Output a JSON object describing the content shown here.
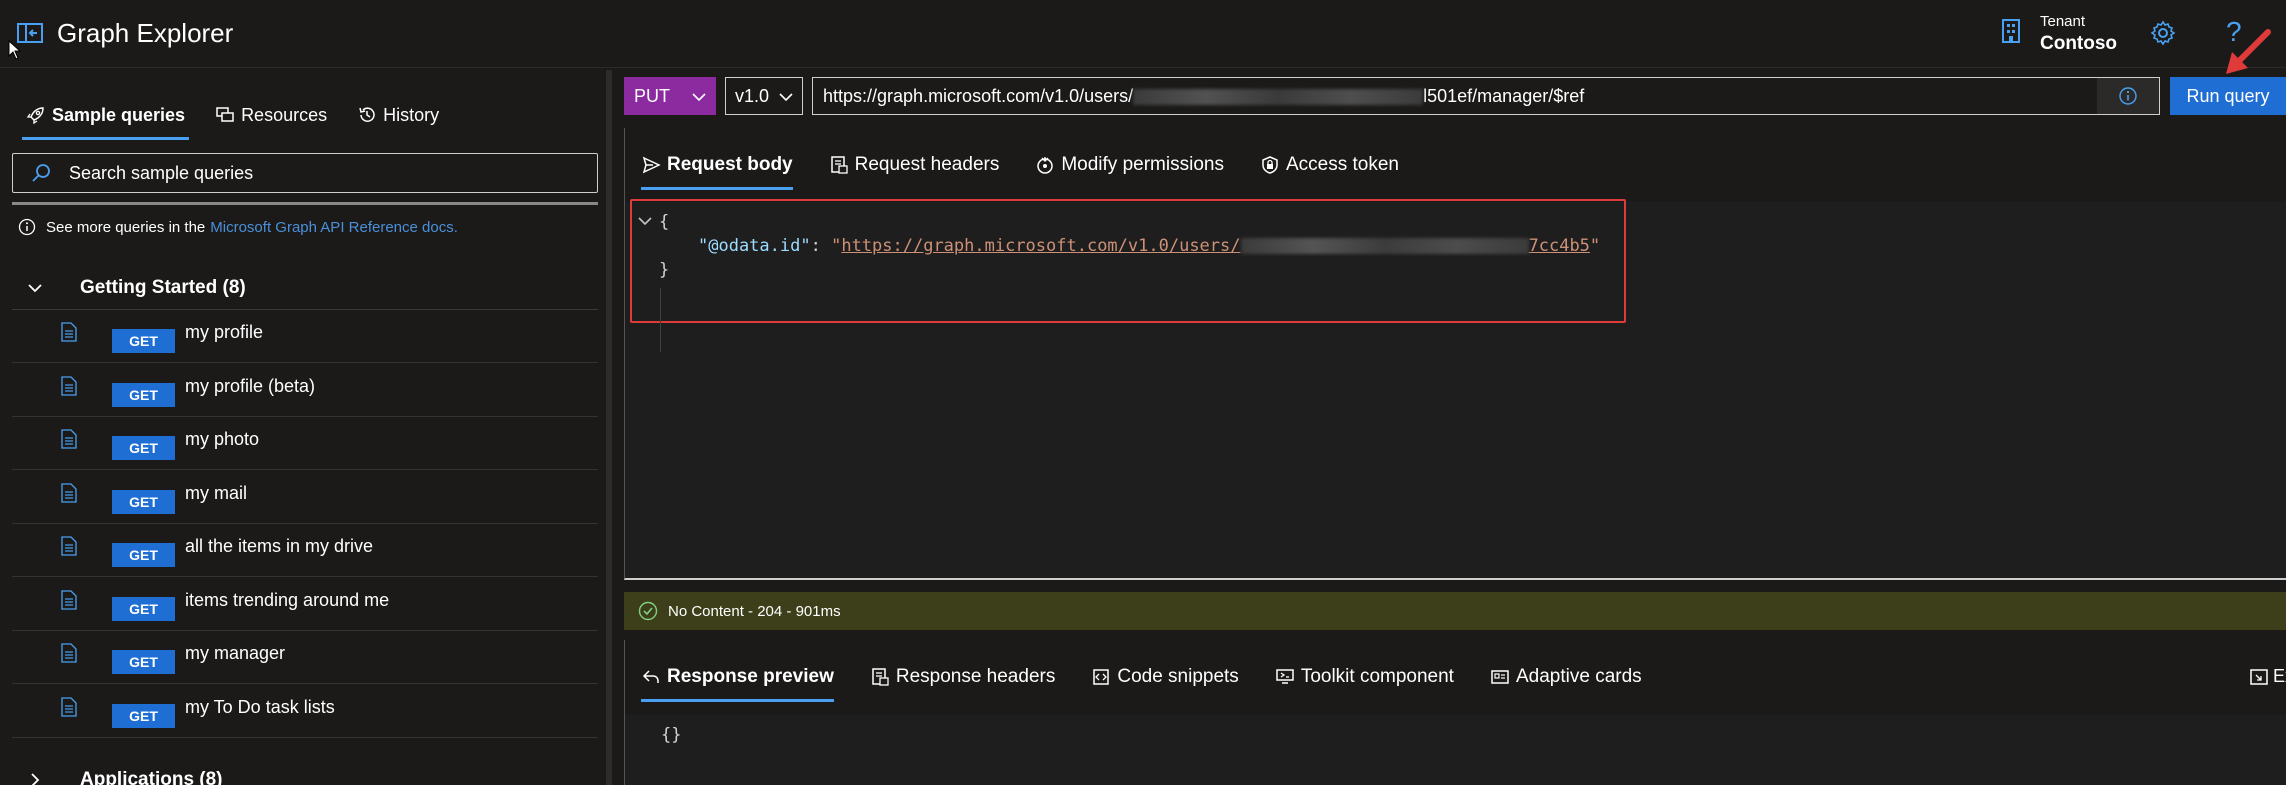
{
  "header": {
    "app_title": "Graph Explorer",
    "tenant_label": "Tenant",
    "tenant_name": "Contoso",
    "help_glyph": "?"
  },
  "sidebar": {
    "tabs": [
      {
        "label": "Sample queries",
        "icon": "rocket-icon",
        "active": true
      },
      {
        "label": "Resources",
        "icon": "resources-icon",
        "active": false
      },
      {
        "label": "History",
        "icon": "history-icon",
        "active": false
      }
    ],
    "search_placeholder": "Search sample queries",
    "info_text": "See more queries in the",
    "info_link": "Microsoft Graph API Reference docs.",
    "groups": [
      {
        "title": "Getting Started (8)",
        "expanded": true,
        "queries": [
          {
            "method": "GET",
            "label": "my profile"
          },
          {
            "method": "GET",
            "label": "my profile (beta)"
          },
          {
            "method": "GET",
            "label": "my photo"
          },
          {
            "method": "GET",
            "label": "my mail"
          },
          {
            "method": "GET",
            "label": "all the items in my drive"
          },
          {
            "method": "GET",
            "label": "items trending around me"
          },
          {
            "method": "GET",
            "label": "my manager"
          },
          {
            "method": "GET",
            "label": "my To Do task lists"
          }
        ]
      },
      {
        "title": "Applications (8)",
        "expanded": false
      }
    ]
  },
  "query_bar": {
    "method": "PUT",
    "version": "v1.0",
    "url_prefix": "https://graph.microsoft.com/v1.0/users/",
    "url_suffix": "l501ef/manager/$ref",
    "run_label": "Run query"
  },
  "request": {
    "tabs": [
      {
        "label": "Request body",
        "icon": "send-icon",
        "active": true
      },
      {
        "label": "Request headers",
        "icon": "headers-icon",
        "active": false
      },
      {
        "label": "Modify permissions",
        "icon": "permissions-icon",
        "active": false
      },
      {
        "label": "Access token",
        "icon": "token-icon",
        "active": false
      }
    ],
    "body_open": "{",
    "body_key": "\"@odata.id\"",
    "body_colon": ": ",
    "body_url_prefix": "https://graph.microsoft.com/v1.0/users/",
    "body_url_suffix": "7cc4b5",
    "body_close": "}"
  },
  "status": {
    "text": "No Content - 204 - 901ms",
    "color": "#3d3f1a"
  },
  "response": {
    "tabs": [
      {
        "label": "Response preview",
        "icon": "preview-icon",
        "active": true
      },
      {
        "label": "Response headers",
        "icon": "headers-icon",
        "active": false
      },
      {
        "label": "Code snippets",
        "icon": "code-icon",
        "active": false
      },
      {
        "label": "Toolkit component",
        "icon": "toolkit-icon",
        "active": false
      },
      {
        "label": "Adaptive cards",
        "icon": "cards-icon",
        "active": false
      }
    ],
    "expand_label": "Ex",
    "body": "{}"
  },
  "colors": {
    "accent": "#1f6ed4",
    "method_put": "#8c2ba0",
    "highlight": "#e03b3b"
  }
}
